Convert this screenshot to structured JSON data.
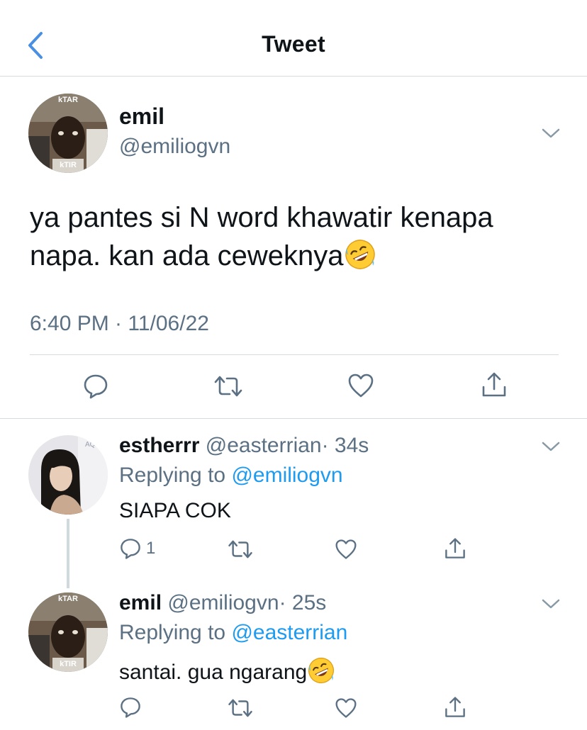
{
  "header": {
    "title": "Tweet",
    "back_icon": "chevron-left-icon"
  },
  "main_tweet": {
    "avatar_top_text": "kTAR",
    "avatar_bottom_text": "kTIR",
    "name": "emil",
    "handle": "@emiliogvn",
    "text_line1": "ya pantes si N word khawatir kenapa",
    "text_line2": "napa. kan ada ceweknya",
    "emoji": "rolling-on-floor-laughing",
    "timestamp": "6:40 PM · 11/06/22"
  },
  "replies": [
    {
      "name": "estherrr",
      "handle": "@easterrian",
      "time": "· 34s",
      "replying_label": "Replying to",
      "replying_to": "@emiliogvn",
      "text": "SIAPA COK",
      "reply_count": "1"
    },
    {
      "avatar_top_text": "kTAR",
      "avatar_bottom_text": "kTIR",
      "name": "emil",
      "handle": "@emiliogvn",
      "time": "· 25s",
      "replying_label": "Replying to",
      "replying_to": "@easterrian",
      "text": "santai. gua ngarang",
      "emoji": "rolling-on-floor-laughing"
    }
  ],
  "colors": {
    "link": "#1d9bf0",
    "secondary": "#5b7083",
    "divider": "#d6dbe0",
    "accent": "#4a90e2"
  }
}
